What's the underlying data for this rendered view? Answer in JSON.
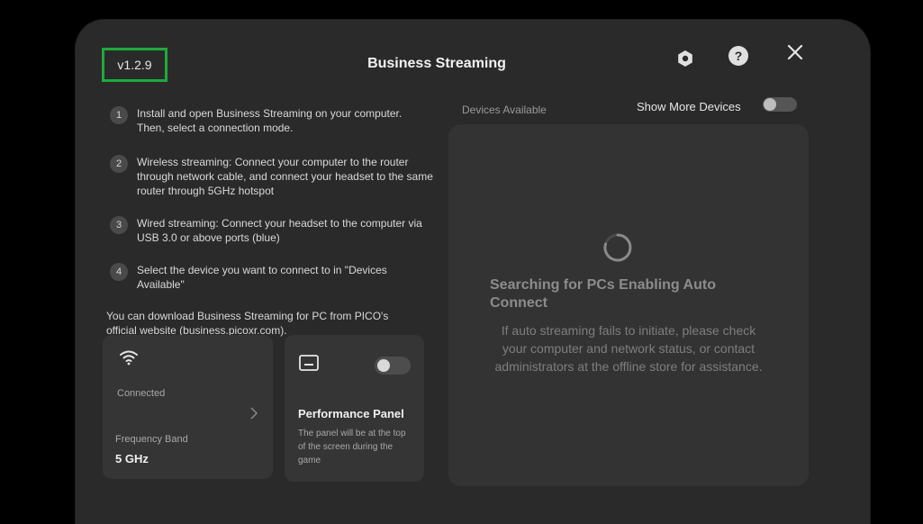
{
  "header": {
    "version": "v1.2.9",
    "title": "Business Streaming",
    "settings_icon": "gear-icon",
    "help_icon": "help-icon",
    "close_icon": "close-icon"
  },
  "steps": [
    {
      "num": "1",
      "text": "Install and open Business Streaming on your computer. Then, select a connection mode."
    },
    {
      "num": "2",
      "text": "Wireless streaming: Connect your computer to the router through network cable, and connect your headset to the same router through 5GHz hotspot"
    },
    {
      "num": "3",
      "text": "Wired streaming: Connect your headset to the computer via USB 3.0 or above ports (blue)"
    },
    {
      "num": "4",
      "text": "Select the device you want to connect to in \"Devices Available\""
    }
  ],
  "download_text": "You can download Business Streaming for PC from PICO's official website (business.picoxr.com).",
  "wifi_card": {
    "icon": "wifi-icon",
    "status": "Connected",
    "band_label": "Frequency Band",
    "band_value": "5 GHz"
  },
  "performance_card": {
    "icon": "panel-icon",
    "title": "Performance Panel",
    "description": "The panel will be at the top of the screen during the game",
    "toggle_on": false
  },
  "devices": {
    "label": "Devices Available",
    "show_more_label": "Show More Devices",
    "show_more_on": false,
    "searching_title": "Searching for PCs Enabling Auto Connect",
    "searching_desc": "If auto streaming fails to initiate, please check your computer and network status, or contact administrators at the offline store for assistance."
  },
  "colors": {
    "panel_bg": "#2a2a2a",
    "highlight": "#1faa3c"
  }
}
